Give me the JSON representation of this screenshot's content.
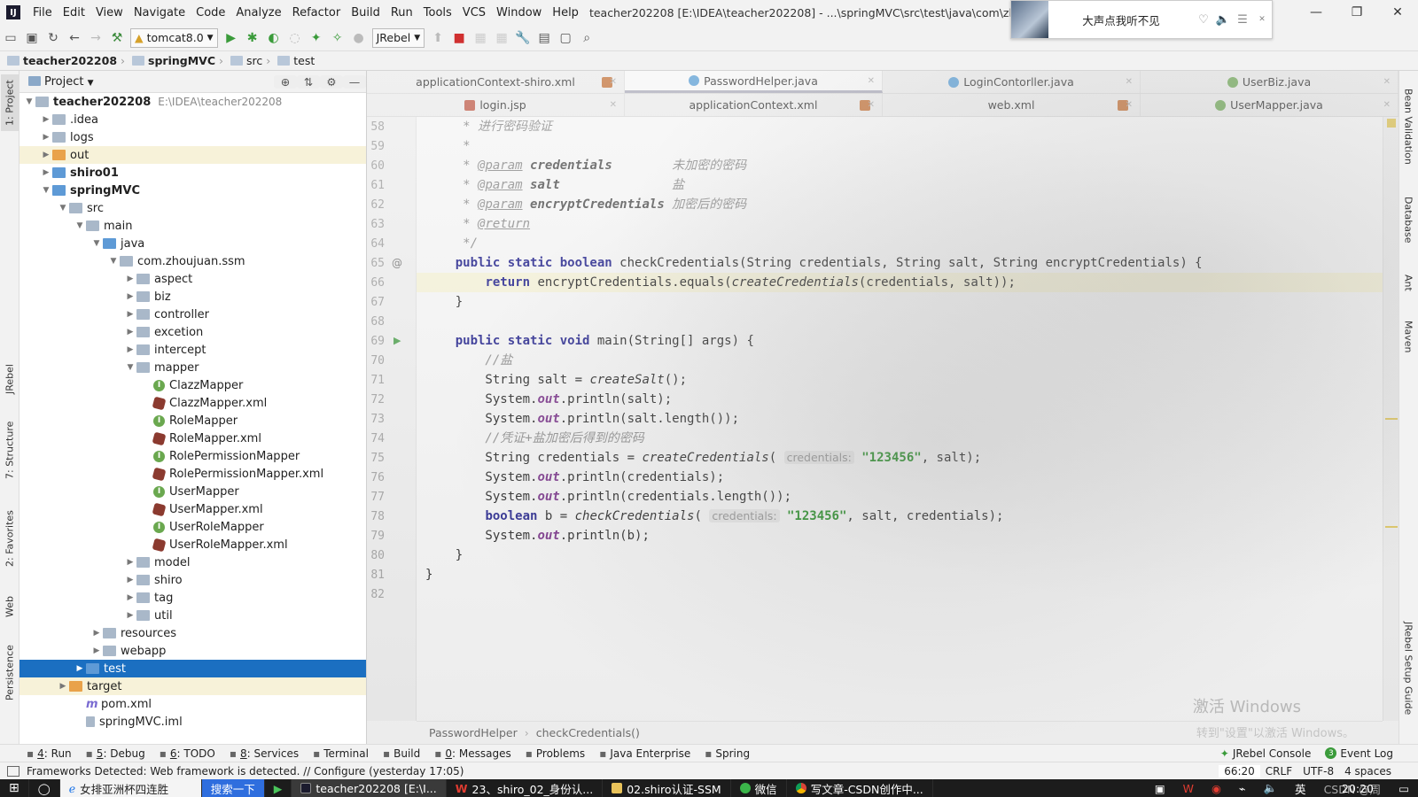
{
  "menubar": {
    "items": [
      "File",
      "Edit",
      "View",
      "Navigate",
      "Code",
      "Analyze",
      "Refactor",
      "Build",
      "Run",
      "Tools",
      "VCS",
      "Window",
      "Help"
    ],
    "window_title": "teacher202208 [E:\\IDEA\\teacher202208] - ...\\springMVC\\src\\test\\java\\com\\zhoujuan\\shiro"
  },
  "music": {
    "title": "大声点我听不见"
  },
  "toolbar": {
    "run_config": "tomcat8.0",
    "jrebel": "JRebel"
  },
  "navbar": {
    "crumbs": [
      "teacher202208",
      "springMVC",
      "src",
      "test"
    ]
  },
  "left_tabs": [
    "1: Project",
    "JRebel",
    "7: Structure",
    "2: Favorites",
    "Web",
    "Persistence"
  ],
  "right_tabs": [
    "Bean Validation",
    "Database",
    "Ant",
    "Maven",
    "JRebel Setup Guide"
  ],
  "project": {
    "title": "Project",
    "root": "teacher202208",
    "root_path": "E:\\IDEA\\teacher202208",
    "tree": [
      {
        "label": "teacher202208",
        "depth": 0,
        "arrow": "v",
        "icon": "gray",
        "bold": true
      },
      {
        "label": ".idea",
        "depth": 1,
        "arrow": ">",
        "icon": "gray"
      },
      {
        "label": "logs",
        "depth": 1,
        "arrow": ">",
        "icon": "gray"
      },
      {
        "label": "out",
        "depth": 1,
        "arrow": ">",
        "icon": "orange",
        "hl": true
      },
      {
        "label": "shiro01",
        "depth": 1,
        "arrow": ">",
        "icon": "blue",
        "bold": true
      },
      {
        "label": "springMVC",
        "depth": 1,
        "arrow": "v",
        "icon": "blue",
        "bold": true
      },
      {
        "label": "src",
        "depth": 2,
        "arrow": "v",
        "icon": "gray"
      },
      {
        "label": "main",
        "depth": 3,
        "arrow": "v",
        "icon": "gray"
      },
      {
        "label": "java",
        "depth": 4,
        "arrow": "v",
        "icon": "blue"
      },
      {
        "label": "com.zhoujuan.ssm",
        "depth": 5,
        "arrow": "v",
        "icon": "gray"
      },
      {
        "label": "aspect",
        "depth": 6,
        "arrow": ">",
        "icon": "gray"
      },
      {
        "label": "biz",
        "depth": 6,
        "arrow": ">",
        "icon": "gray"
      },
      {
        "label": "controller",
        "depth": 6,
        "arrow": ">",
        "icon": "gray"
      },
      {
        "label": "excetion",
        "depth": 6,
        "arrow": ">",
        "icon": "gray"
      },
      {
        "label": "intercept",
        "depth": 6,
        "arrow": ">",
        "icon": "gray"
      },
      {
        "label": "mapper",
        "depth": 6,
        "arrow": "v",
        "icon": "gray"
      },
      {
        "label": "ClazzMapper",
        "depth": 7,
        "arrow": "",
        "icon": "i"
      },
      {
        "label": "ClazzMapper.xml",
        "depth": 7,
        "arrow": "",
        "icon": "x"
      },
      {
        "label": "RoleMapper",
        "depth": 7,
        "arrow": "",
        "icon": "i"
      },
      {
        "label": "RoleMapper.xml",
        "depth": 7,
        "arrow": "",
        "icon": "x"
      },
      {
        "label": "RolePermissionMapper",
        "depth": 7,
        "arrow": "",
        "icon": "i"
      },
      {
        "label": "RolePermissionMapper.xml",
        "depth": 7,
        "arrow": "",
        "icon": "x"
      },
      {
        "label": "UserMapper",
        "depth": 7,
        "arrow": "",
        "icon": "i"
      },
      {
        "label": "UserMapper.xml",
        "depth": 7,
        "arrow": "",
        "icon": "x"
      },
      {
        "label": "UserRoleMapper",
        "depth": 7,
        "arrow": "",
        "icon": "i"
      },
      {
        "label": "UserRoleMapper.xml",
        "depth": 7,
        "arrow": "",
        "icon": "x"
      },
      {
        "label": "model",
        "depth": 6,
        "arrow": ">",
        "icon": "gray"
      },
      {
        "label": "shiro",
        "depth": 6,
        "arrow": ">",
        "icon": "gray"
      },
      {
        "label": "tag",
        "depth": 6,
        "arrow": ">",
        "icon": "gray"
      },
      {
        "label": "util",
        "depth": 6,
        "arrow": ">",
        "icon": "gray"
      },
      {
        "label": "resources",
        "depth": 4,
        "arrow": ">",
        "icon": "gray"
      },
      {
        "label": "webapp",
        "depth": 4,
        "arrow": ">",
        "icon": "gray"
      },
      {
        "label": "test",
        "depth": 3,
        "arrow": ">",
        "icon": "blue",
        "sel": true
      },
      {
        "label": "target",
        "depth": 2,
        "arrow": ">",
        "icon": "orange",
        "hl": true
      },
      {
        "label": "pom.xml",
        "depth": 3,
        "arrow": "",
        "icon": "m"
      },
      {
        "label": "springMVC.iml",
        "depth": 3,
        "arrow": "",
        "icon": "iml"
      }
    ]
  },
  "editor": {
    "tabs_row1": [
      {
        "label": "applicationContext-shiro.xml",
        "icon": "x"
      },
      {
        "label": "PasswordHelper.java",
        "icon": "c",
        "active": true
      },
      {
        "label": "LoginContorller.java",
        "icon": "c"
      },
      {
        "label": "UserBiz.java",
        "icon": "i"
      }
    ],
    "tabs_row2": [
      {
        "label": "login.jsp",
        "icon": "j"
      },
      {
        "label": "applicationContext.xml",
        "icon": "x"
      },
      {
        "label": "web.xml",
        "icon": "x"
      },
      {
        "label": "UserMapper.java",
        "icon": "i"
      }
    ],
    "line_numbers": [
      "58",
      "59",
      "60",
      "61",
      "62",
      "63",
      "64",
      "65",
      "66",
      "67",
      "68",
      "69",
      "70",
      "71",
      "72",
      "73",
      "74",
      "75",
      "76",
      "77",
      "78",
      "79",
      "80",
      "81",
      "82"
    ],
    "current_line": "66",
    "breadcrumb": [
      "PasswordHelper",
      "checkCredentials()"
    ],
    "watermark": "激活 Windows",
    "watermark_sub": "转到\"设置\"以激活 Windows。"
  },
  "toolwindows": [
    {
      "num": "4",
      "label": ": Run"
    },
    {
      "num": "5",
      "label": ": Debug"
    },
    {
      "num": "6",
      "label": ": TODO"
    },
    {
      "num": "8",
      "label": ": Services"
    },
    {
      "num": "",
      "label": "Terminal"
    },
    {
      "num": "",
      "label": "Build"
    },
    {
      "num": "0",
      "label": ": Messages"
    },
    {
      "num": "",
      "label": "Problems"
    },
    {
      "num": "",
      "label": "Java Enterprise"
    },
    {
      "num": "",
      "label": "Spring"
    }
  ],
  "toolwindows_right": [
    "JRebel Console",
    "Event Log"
  ],
  "event_count": "3",
  "status": {
    "message": "Frameworks Detected: Web framework is detected. // Configure (yesterday 17:05)",
    "position": "66:20",
    "line_sep": "CRLF",
    "encoding": "UTF-8",
    "indent": "4 spaces"
  },
  "taskbar": {
    "search": "女排亚洲杯四连胜",
    "search_btn": "搜索一下",
    "apps": [
      "teacher202208 [E:\\I...",
      "23、shiro_02_身份认...",
      "02.shiro认证-SSM",
      "微信",
      "写文章-CSDN创作中..."
    ],
    "ime": "英",
    "time": "20:20",
    "csdn": "CSDN @周"
  }
}
